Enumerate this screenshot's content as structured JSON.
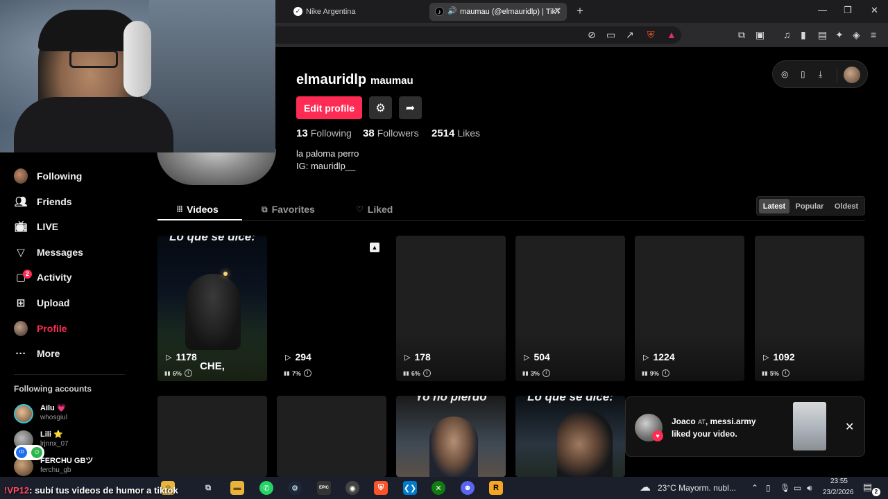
{
  "browser": {
    "tabs": [
      {
        "title": "Nike Argentina",
        "active": false
      },
      {
        "title": "maumau (@elmauridlp) | TikT",
        "active": true
      }
    ],
    "new_tab_symbol": "+",
    "window_controls": [
      "—",
      "❐",
      "✕"
    ]
  },
  "sidebar": {
    "items": [
      {
        "label": "Following",
        "icon": "avatar-icon"
      },
      {
        "label": "Friends",
        "icon": "friends-icon"
      },
      {
        "label": "LIVE",
        "icon": "live-icon"
      },
      {
        "label": "Messages",
        "icon": "messages-icon"
      },
      {
        "label": "Activity",
        "icon": "activity-icon",
        "badge": "2"
      },
      {
        "label": "Upload",
        "icon": "upload-icon"
      },
      {
        "label": "Profile",
        "icon": "profile-avatar-icon",
        "active": true
      },
      {
        "label": "More",
        "icon": "more-icon"
      }
    ],
    "following_accounts_title": "Following accounts",
    "accounts": [
      {
        "name": "Ailu 💗",
        "handle": "whosgiul"
      },
      {
        "name": "Lili ⭐",
        "handle": "lrjnnx_07"
      },
      {
        "name": "FERCHU GBツ",
        "handle": "ferchu_gb"
      }
    ]
  },
  "profile": {
    "username": "elmauridlp",
    "nickname": "maumau",
    "edit_label": "Edit profile",
    "stats": [
      {
        "value": "13",
        "label": "Following"
      },
      {
        "value": "38",
        "label": "Followers"
      },
      {
        "value": "2514",
        "label": "Likes"
      }
    ],
    "bio": [
      "la paloma perro",
      "IG: mauridlp__"
    ]
  },
  "content_tabs": [
    {
      "label": "Videos",
      "active": true
    },
    {
      "label": "Favorites",
      "active": false
    },
    {
      "label": "Liked",
      "active": false
    }
  ],
  "sort_options": [
    {
      "label": "Latest",
      "active": true
    },
    {
      "label": "Popular",
      "active": false
    },
    {
      "label": "Oldest",
      "active": false
    }
  ],
  "videos_row1": [
    {
      "views": "1178",
      "rate": "6%",
      "caption_top": "Lo que se dice:",
      "caption_bottom": "CHE,"
    },
    {
      "views": "294",
      "rate": "7%",
      "photo_badge": true
    },
    {
      "views": "178",
      "rate": "6%"
    },
    {
      "views": "504",
      "rate": "3%"
    },
    {
      "views": "1224",
      "rate": "9%"
    },
    {
      "views": "1092",
      "rate": "5%"
    }
  ],
  "videos_row2": [
    {
      "caption_top": ""
    },
    {
      "caption_top": ""
    },
    {
      "caption_top": "Yo no pierdo"
    },
    {
      "caption_top": "Lo que se dice:"
    }
  ],
  "notification": {
    "line1_name": "Joaco",
    "line1_small": "AT",
    "line1_rest": ", messi.army",
    "line2": "liked your video."
  },
  "stream_overlay": {
    "prefix": "!VP12",
    "text": ": subí tus videos de humor a tiktok"
  },
  "taskbar": {
    "weather": "23°C  Mayorm. nubl...",
    "time": "23:55",
    "date": "23/2/2026",
    "notification_count": "2"
  },
  "colors": {
    "accent": "#fe2c55",
    "background": "#000000"
  }
}
